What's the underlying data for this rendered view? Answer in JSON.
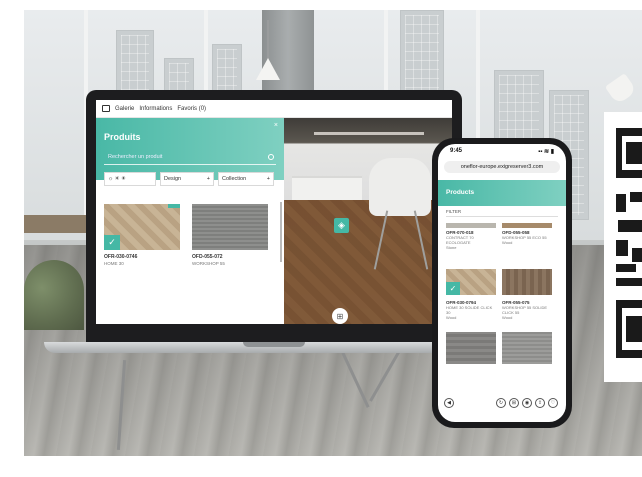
{
  "laptop_app": {
    "topbar": {
      "galerie": "Galerie",
      "informations": "Informations",
      "favoris": "Favoris (0)"
    },
    "panel": {
      "title": "Produits",
      "close": "×",
      "search_placeholder": "Rechercher un produit",
      "filters": {
        "light": "☼ ☀ ☀",
        "design": "Design",
        "collection": "Collection",
        "plus": "+"
      },
      "tiles": [
        {
          "code": "OFR-030-0746",
          "name": "HOME 30"
        },
        {
          "code": "OFD-055-072",
          "name": "WORKSHOP 55"
        }
      ]
    }
  },
  "phone_app": {
    "time": "9:45",
    "status_icons": "▪▪ ≋ ▮",
    "url": "oneflor-europe.exigreserver3.com",
    "panel_title": "Products",
    "filter_label": "FILTER",
    "tiles_row1": [
      {
        "code": "OFR-070-018",
        "name": "CONTRACT 70 ECOLOGATE",
        "sub": "Stone"
      },
      {
        "code": "OFD-055-058",
        "name": "WORKSHOP 55 ECO 55",
        "sub": "Wood"
      }
    ],
    "tiles_row2": [
      {
        "code": "OFR-030-0794",
        "name": "HOME 30 SOLIDE CLICK 30",
        "sub": "Wood"
      },
      {
        "code": "OFR-055-075",
        "name": "WORKSHOP 55 SOLIDE CLICK 55",
        "sub": "Wood"
      }
    ]
  },
  "colors": {
    "accent": "#45b8a5",
    "accent_light": "#7fd0c1"
  }
}
